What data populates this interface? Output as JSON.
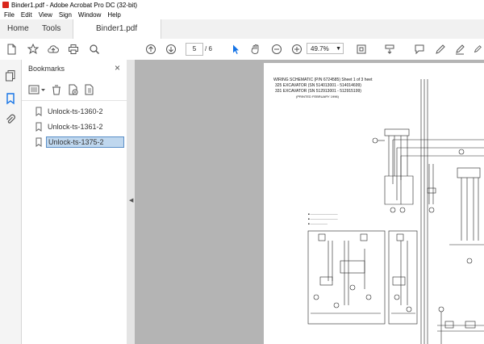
{
  "window": {
    "title": "Binder1.pdf - Adobe Acrobat Pro DC (32-bit)"
  },
  "menu": [
    "File",
    "Edit",
    "View",
    "Sign",
    "Window",
    "Help"
  ],
  "tabs": {
    "home": "Home",
    "tools": "Tools",
    "document": "Binder1.pdf",
    "close": "×"
  },
  "toolbar": {
    "page_current": "5",
    "page_total": "/ 6",
    "zoom": "49.7%",
    "zoom_arrow": "▼"
  },
  "bookmarks": {
    "title": "Bookmarks",
    "close": "×",
    "items": [
      {
        "label": "Unlock-ts-1360-2",
        "selected": false
      },
      {
        "label": "Unlock-ts-1361-2",
        "selected": false
      },
      {
        "label": "Unlock-ts-1375-2",
        "selected": true
      }
    ]
  },
  "document": {
    "heading_line1": "WIRING SCHEMATIC (P/N 6724585) Sheet 1 of 3 heet",
    "heading_line2": "325 EXCAVATOR (SN 514013001 - 514014699)",
    "heading_line3": "331 EXCAVATOR (SN 512913001 - 512915199)",
    "heading_line4": "(PRINTED FEBRUARY 1996)"
  },
  "colors": {
    "accent": "#1473e6",
    "selection": "#bfd7ee",
    "acrobat_red": "#d9261c"
  }
}
